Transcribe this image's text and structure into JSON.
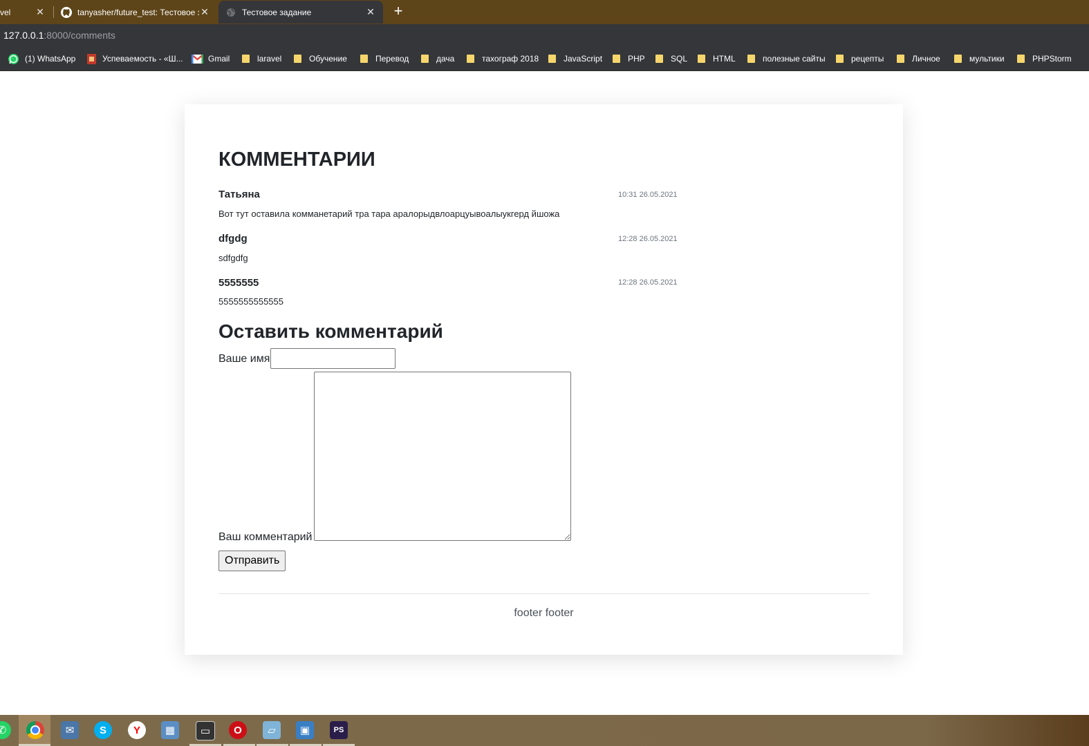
{
  "browser": {
    "tabs": [
      {
        "title": "vel",
        "favicon": "laravel-icon"
      },
      {
        "title": "tanyasher/future_test: Тестовое з",
        "favicon": "github-icon"
      },
      {
        "title": "Тестовое задание",
        "favicon": "globe-icon"
      }
    ],
    "url_host": "127.0.0.1",
    "url_rest": ":8000/comments",
    "bookmarks": [
      {
        "label": "(1) WhatsApp",
        "icon": "whatsapp-icon"
      },
      {
        "label": "Успеваемость - «Ш...",
        "icon": "school-icon"
      },
      {
        "label": "Gmail",
        "icon": "gmail-icon"
      },
      {
        "label": "laravel",
        "icon": "folder-icon"
      },
      {
        "label": "Обучение",
        "icon": "folder-icon"
      },
      {
        "label": "Перевод",
        "icon": "folder-icon"
      },
      {
        "label": "дача",
        "icon": "folder-icon"
      },
      {
        "label": "тахограф 2018",
        "icon": "folder-icon"
      },
      {
        "label": "JavaScript",
        "icon": "folder-icon"
      },
      {
        "label": "PHP",
        "icon": "folder-icon"
      },
      {
        "label": "SQL",
        "icon": "folder-icon"
      },
      {
        "label": "HTML",
        "icon": "folder-icon"
      },
      {
        "label": "полезные сайты",
        "icon": "folder-icon"
      },
      {
        "label": "рецепты",
        "icon": "folder-icon"
      },
      {
        "label": "Личное",
        "icon": "folder-icon"
      },
      {
        "label": "мультики",
        "icon": "folder-icon"
      },
      {
        "label": "PHPStorm",
        "icon": "folder-icon"
      }
    ]
  },
  "page": {
    "heading": "КОММЕНТАРИИ",
    "comments": [
      {
        "author": "Татьяна",
        "date": "10:31 26.05.2021",
        "text": "Вот тут оставила комманетарий тра тара аралорыдвлоарцуывоалыукгерд йшожа"
      },
      {
        "author": "dfgdg",
        "date": "12:28 26.05.2021",
        "text": "sdfgdfg"
      },
      {
        "author": "5555555",
        "date": "12:28 26.05.2021",
        "text": "5555555555555"
      }
    ],
    "form": {
      "heading": "Оставить комментарий",
      "name_label": "Ваше имя",
      "name_value": "",
      "comment_label": "Ваш комментарий",
      "comment_value": "",
      "submit_label": "Отправить"
    },
    "footer": "footer footer"
  },
  "taskbar": {
    "apps": [
      {
        "name": "whatsapp-icon",
        "color": "#25d366"
      },
      {
        "name": "chrome-icon",
        "color": "#db4437"
      },
      {
        "name": "messenger-icon",
        "color": "#4a76a8"
      },
      {
        "name": "skype-icon",
        "color": "#00aff0"
      },
      {
        "name": "yandex-browser-icon",
        "color": "#ff0000"
      },
      {
        "name": "calculator-icon",
        "color": "#5b8ec4"
      },
      {
        "name": "terminal-icon",
        "color": "#333333"
      },
      {
        "name": "opera-icon",
        "color": "#cc0f16"
      },
      {
        "name": "notepad-icon",
        "color": "#7fb4d8"
      },
      {
        "name": "photos-icon",
        "color": "#3a7fc4"
      },
      {
        "name": "phpstorm-icon",
        "color": "#2b1d4a"
      }
    ]
  }
}
